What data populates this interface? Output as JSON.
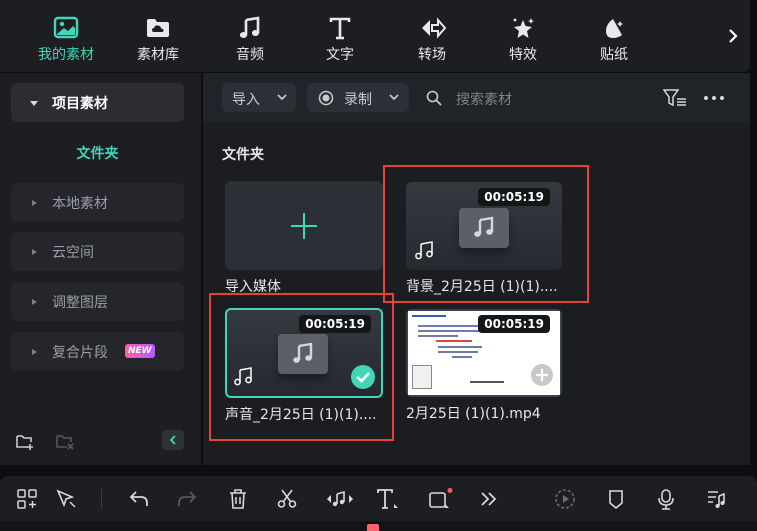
{
  "tabs": [
    {
      "label": "我的素材",
      "icon": "media-icon",
      "active": true
    },
    {
      "label": "素材库",
      "icon": "cloud-folder-icon",
      "active": false
    },
    {
      "label": "音频",
      "icon": "music-icon",
      "active": false
    },
    {
      "label": "文字",
      "icon": "text-icon",
      "active": false
    },
    {
      "label": "转场",
      "icon": "transition-icon",
      "active": false
    },
    {
      "label": "特效",
      "icon": "effects-icon",
      "active": false
    },
    {
      "label": "贴纸",
      "icon": "sticker-icon",
      "active": false
    }
  ],
  "sidebar": {
    "project_media": "项目素材",
    "folder": "文件夹",
    "items": [
      {
        "label": "本地素材"
      },
      {
        "label": "云空间"
      },
      {
        "label": "调整图层"
      },
      {
        "label": "复合片段",
        "badge": "NEW"
      }
    ]
  },
  "toolbar": {
    "import_label": "导入",
    "record_label": "录制",
    "search_placeholder": "搜索素材"
  },
  "content": {
    "section_title": "文件夹",
    "import_media_label": "导入媒体",
    "items": [
      {
        "name": "背景_2月25日 (1)(1)....",
        "duration": "00:05:19",
        "type": "audio",
        "selected": false,
        "highlighted": true
      },
      {
        "name": "声音_2月25日 (1)(1)....",
        "duration": "00:05:19",
        "type": "audio",
        "selected": true,
        "highlighted": true
      },
      {
        "name": "2月25日 (1)(1).mp4",
        "duration": "00:05:19",
        "type": "video",
        "selected": false,
        "highlighted": false
      }
    ]
  },
  "colors": {
    "accent": "#42d6b9",
    "highlight_box": "#e8403f",
    "playhead": "#ff6468"
  }
}
